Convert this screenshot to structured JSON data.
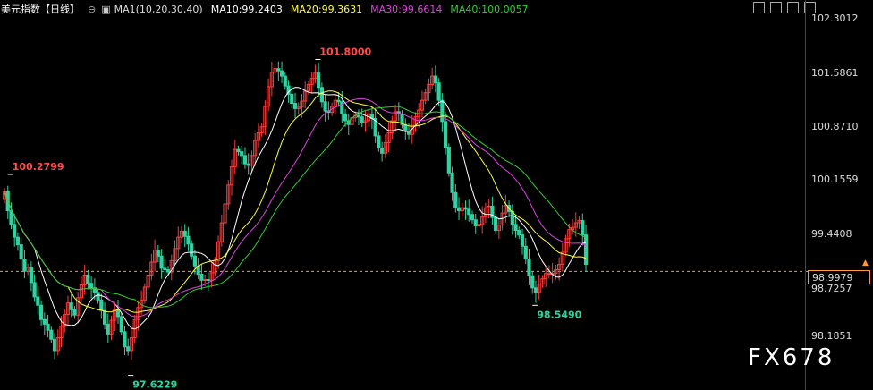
{
  "header": {
    "title": "美元指数【日线】",
    "indicator": "MA1(10,20,30,40)",
    "ma10": "MA10:99.2403",
    "ma20": "MA20:99.3631",
    "ma30": "MA30:99.6614",
    "ma40": "MA40:100.0057"
  },
  "colors": {
    "up": "#ff3b3b",
    "down": "#2ed3a2",
    "ma10": "#ffffff",
    "ma20": "#ffff33",
    "ma30": "#dd44dd",
    "ma40": "#33cc33",
    "current_line": "#ff9933"
  },
  "watermark": "FX678",
  "current_price": "98.9979",
  "chart_data": {
    "type": "candlestick",
    "y_ticks": [
      "102.3012",
      "101.5861",
      "100.8710",
      "100.1559",
      "99.4408",
      "98.7257",
      "98.1851"
    ],
    "ylim": [
      97.5,
      102.35
    ],
    "annotations": [
      {
        "text": "100.2799",
        "x": 1,
        "y": 100.2799,
        "kind": "high"
      },
      {
        "text": "97.6229",
        "x": 37,
        "y": 97.6229,
        "kind": "low"
      },
      {
        "text": "101.8000",
        "x": 93,
        "y": 101.8,
        "kind": "high"
      },
      {
        "text": "98.5490",
        "x": 158,
        "y": 98.549,
        "kind": "low"
      }
    ],
    "current_line": 98.9979,
    "series_close": [
      100.05,
      99.8,
      99.62,
      99.45,
      99.35,
      99.16,
      99.0,
      99.05,
      98.85,
      98.66,
      98.55,
      98.36,
      98.3,
      98.22,
      98.1,
      97.95,
      98.12,
      98.27,
      98.43,
      98.58,
      98.49,
      98.42,
      98.65,
      98.82,
      98.95,
      98.84,
      98.78,
      98.72,
      98.62,
      98.48,
      98.3,
      98.17,
      98.35,
      98.5,
      98.4,
      98.2,
      98.0,
      97.95,
      98.12,
      98.36,
      98.52,
      98.62,
      98.79,
      98.95,
      99.12,
      99.28,
      99.2,
      99.04,
      99.02,
      98.99,
      99.14,
      99.3,
      99.45,
      99.53,
      99.46,
      99.36,
      99.2,
      99.07,
      98.96,
      98.88,
      98.89,
      98.88,
      98.98,
      99.14,
      99.39,
      99.64,
      99.89,
      100.14,
      100.38,
      100.61,
      100.58,
      100.53,
      100.42,
      100.4,
      100.53,
      100.73,
      100.83,
      100.91,
      101.18,
      101.44,
      101.63,
      101.68,
      101.65,
      101.58,
      101.45,
      101.34,
      101.22,
      101.15,
      101.17,
      101.25,
      101.38,
      101.47,
      101.55,
      101.62,
      101.43,
      101.24,
      101.12,
      101.1,
      101.18,
      101.26,
      101.24,
      101.08,
      100.99,
      100.94,
      101.03,
      101.06,
      101.04,
      100.97,
      100.99,
      101.08,
      101.02,
      100.79,
      100.63,
      100.56,
      100.7,
      100.83,
      100.99,
      101.11,
      101.08,
      100.94,
      100.85,
      100.81,
      100.92,
      101.04,
      101.13,
      101.26,
      101.36,
      101.47,
      101.58,
      101.49,
      101.26,
      100.98,
      100.64,
      100.3,
      100.04,
      99.84,
      99.8,
      99.84,
      99.82,
      99.75,
      99.68,
      99.6,
      99.62,
      99.72,
      99.84,
      99.86,
      99.71,
      99.54,
      99.61,
      99.77,
      99.87,
      99.79,
      99.62,
      99.54,
      99.48,
      99.33,
      99.16,
      98.94,
      98.78,
      98.72,
      98.83,
      98.9,
      98.97,
      98.97,
      98.97,
      99.02,
      99.09,
      99.25,
      99.43,
      99.55,
      99.58,
      99.64,
      99.67,
      99.48,
      99.09
    ]
  }
}
